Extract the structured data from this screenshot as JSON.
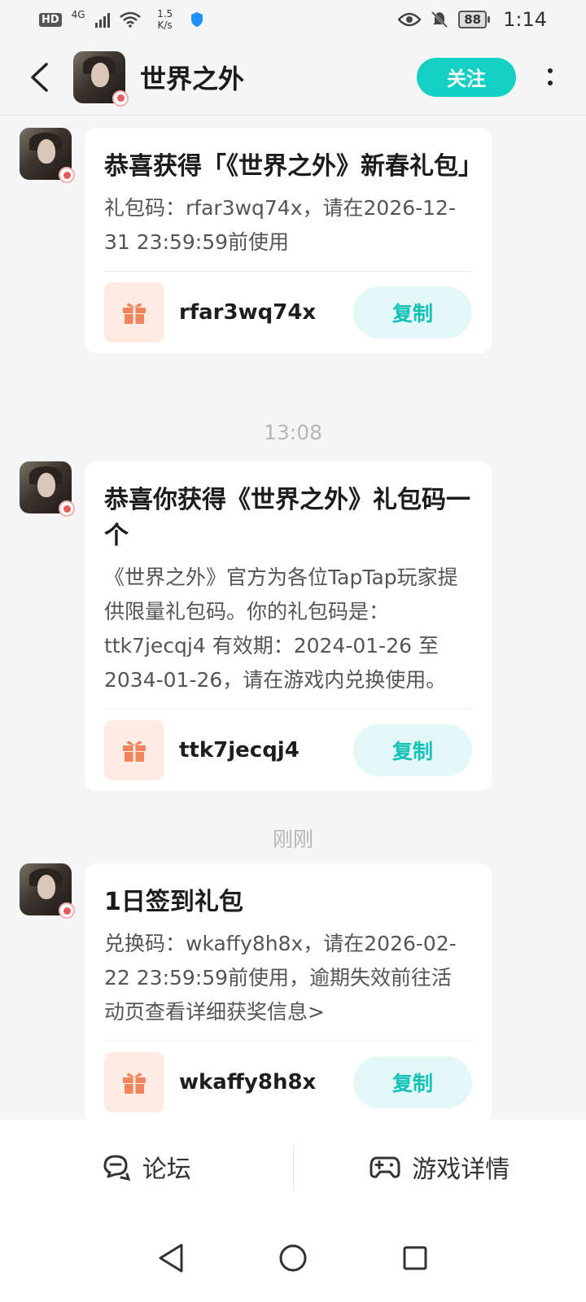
{
  "status_bar": {
    "hd": "HD",
    "network": "4G",
    "speed": "1.5 K/s",
    "battery": "88",
    "time": "1:14"
  },
  "header": {
    "title": "世界之外",
    "follow_label": "关注"
  },
  "messages": [
    {
      "title": "恭喜获得「《世界之外》新春礼包」",
      "body": "礼包码：rfar3wq74x，请在2026-12-31 23:59:59前使用",
      "code": "rfar3wq74x",
      "copy_label": "复制"
    },
    {
      "timestamp": "13:08",
      "title": "恭喜你获得《世界之外》礼包码一个",
      "body": "《世界之外》官方为各位TapTap玩家提供限量礼包码。你的礼包码是：ttk7jecqj4 有效期：2024-01-26 至 2034-01-26，请在游戏内兑换使用。",
      "code": "ttk7jecqj4",
      "copy_label": "复制"
    },
    {
      "timestamp": "刚刚",
      "title": "1日签到礼包",
      "body": "兑换码：wkaffy8h8x，请在2026-02-22 23:59:59前使用，逾期失效前往活动页查看详细获奖信息>",
      "code": "wkaffy8h8x",
      "copy_label": "复制"
    }
  ],
  "bottom_tabs": {
    "forum": "论坛",
    "game_details": "游戏详情"
  },
  "colors": {
    "accent": "#14cfc4",
    "copy_bg": "#e3f8f6",
    "gift": "#f0845c"
  },
  "icons": {
    "back": "back-arrow-icon",
    "more": "more-vertical-icon",
    "gift": "gift-icon",
    "forum": "forum-chat-icon",
    "game": "gamepad-icon"
  }
}
